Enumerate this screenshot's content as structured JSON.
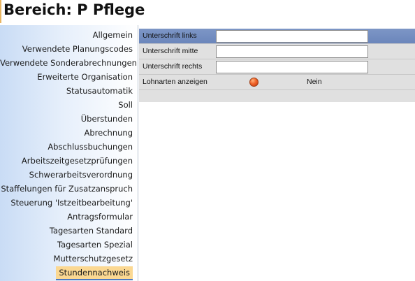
{
  "header": {
    "title": "Bereich: P Pflege"
  },
  "sidebar": {
    "items": [
      {
        "label": "Allgemein"
      },
      {
        "label": "Verwendete Planungscodes"
      },
      {
        "label": "Verwendete Sonderabrechnungen"
      },
      {
        "label": "Erweiterte Organisation"
      },
      {
        "label": "Statusautomatik"
      },
      {
        "label": "Soll"
      },
      {
        "label": "Überstunden"
      },
      {
        "label": "Abrechnung"
      },
      {
        "label": "Abschlussbuchungen"
      },
      {
        "label": "Arbeitszeitgesetzprüfungen"
      },
      {
        "label": "Schwerarbeitsverordnung"
      },
      {
        "label": "Staffelungen für Zusatzanspruch"
      },
      {
        "label": "Steuerung 'Istzeitbearbeitung'"
      },
      {
        "label": "Antragsformular"
      },
      {
        "label": "Tagesarten Standard"
      },
      {
        "label": "Tagesarten Spezial"
      },
      {
        "label": "Mutterschutzgesetz"
      },
      {
        "label": "Stundennachweis",
        "active": true
      }
    ]
  },
  "form": {
    "rows": [
      {
        "label": "Unterschrift links",
        "value": "",
        "selected": true
      },
      {
        "label": "Unterschrift mitte",
        "value": ""
      },
      {
        "label": "Unterschrift rechts",
        "value": ""
      }
    ],
    "toggle": {
      "label": "Lohnarten anzeigen",
      "state_text": "Nein",
      "state_color": "#f0642a"
    }
  },
  "colors": {
    "selected_row": "#7d96c6",
    "active_nav_bg": "#fbd892",
    "active_nav_underline": "#4e79c2",
    "panel_bg": "#e0e0e0"
  }
}
